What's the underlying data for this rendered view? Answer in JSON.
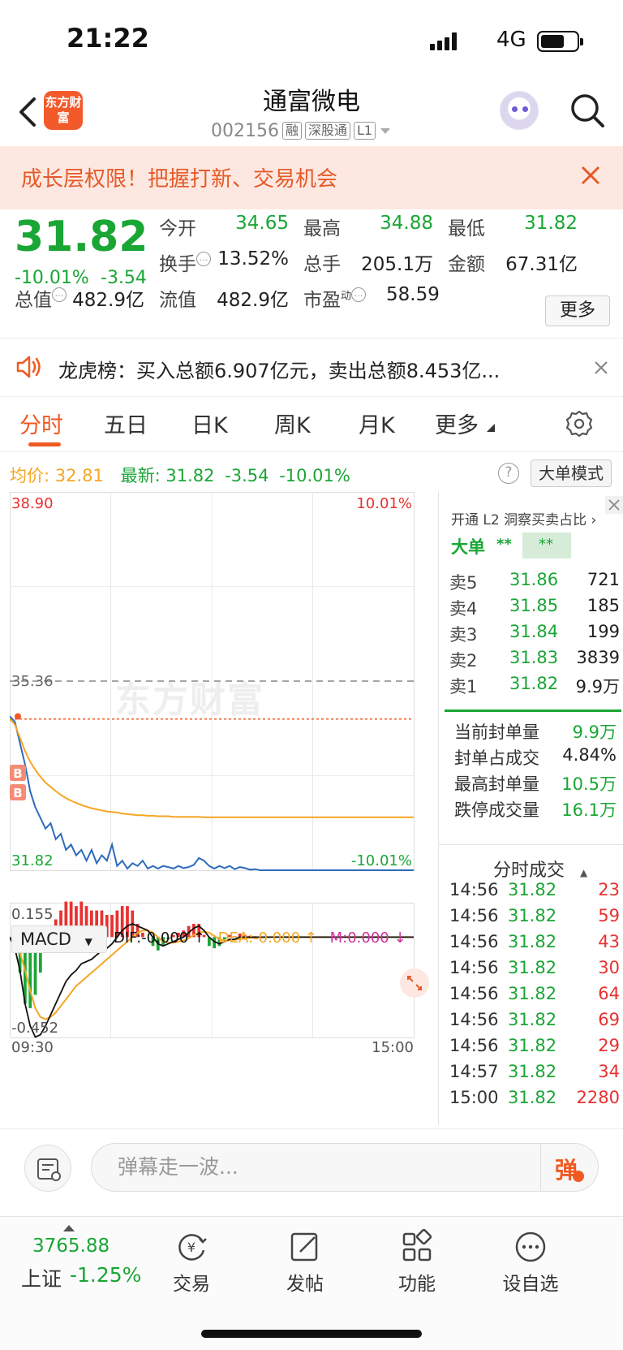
{
  "status": {
    "time": "21:22",
    "network": "4G"
  },
  "header": {
    "logo_text": "东方财富",
    "stock_name": "通富微电",
    "stock_code": "002156",
    "tags": [
      "融",
      "深股通",
      "L1"
    ]
  },
  "promo": {
    "text": "成长层权限！把握打新、交易机会"
  },
  "quote": {
    "price": "31.82",
    "pct": "-10.01%",
    "change": "-3.54",
    "fields": {
      "open_label": "今开",
      "open": "34.65",
      "high_label": "最高",
      "high": "34.88",
      "low_label": "最低",
      "low": "31.82",
      "turnover_label": "换手",
      "turnover": "13.52%",
      "volume_label": "总手",
      "volume": "205.1万",
      "amount_label": "金额",
      "amount": "67.31亿",
      "mktcap_label": "总值",
      "mktcap": "482.9亿",
      "float_label": "流值",
      "float": "482.9亿",
      "pe_label": "市盈",
      "pe_sup": "动",
      "pe": "58.59"
    },
    "more_label": "更多"
  },
  "dragon_tiger": {
    "text": "龙虎榜：买入总额6.907亿元，卖出总额8.453亿..."
  },
  "tabs": [
    "分时",
    "五日",
    "日K",
    "周K",
    "月K",
    "更多"
  ],
  "chart_info": {
    "avg_label": "均价:",
    "avg": "32.81",
    "latest_label": "最新:",
    "latest": "31.82",
    "change": "-3.54",
    "pct": "-10.01%",
    "help": "?",
    "big_order_mode": "大单模式"
  },
  "chart_data": {
    "type": "line",
    "y_top_label": "38.90",
    "y_top_pct": "10.01%",
    "y_mid_label": "35.36",
    "y_bottom_label": "31.82",
    "y_bottom_pct": "-10.01%",
    "ylim": [
      31.82,
      38.9
    ],
    "prev_close": 35.36,
    "limit_line": 34.65,
    "x_start": "09:30",
    "x_end": "15:00",
    "markers": [
      "B",
      "B"
    ],
    "series": [
      {
        "name": "最新",
        "color": "#2f6bbd",
        "values": [
          34.7,
          34.6,
          34.2,
          33.8,
          33.3,
          33.0,
          32.8,
          32.6,
          32.7,
          32.4,
          32.5,
          32.2,
          32.3,
          32.1,
          32.2,
          32.0,
          32.2,
          31.95,
          32.1,
          32.0,
          32.3,
          31.9,
          32.0,
          31.85,
          31.95,
          31.9,
          32.0,
          31.85,
          31.9,
          31.85,
          31.9,
          31.88,
          31.85,
          31.9,
          31.86,
          31.88,
          31.92,
          32.05,
          32.0,
          31.9,
          31.85,
          31.9,
          31.86,
          31.9,
          31.84,
          31.88,
          31.86,
          31.83,
          31.84,
          31.82,
          31.82,
          31.82,
          31.82,
          31.82,
          31.82,
          31.82,
          31.82,
          31.82,
          31.82,
          31.82,
          31.82,
          31.82,
          31.82,
          31.82,
          31.82,
          31.82,
          31.82,
          31.82,
          31.82,
          31.82,
          31.82,
          31.82,
          31.82,
          31.82,
          31.82,
          31.82,
          31.82,
          31.82,
          31.82,
          31.82
        ]
      },
      {
        "name": "均价",
        "color": "#f5a623",
        "values": [
          34.65,
          34.55,
          34.3,
          34.05,
          33.85,
          33.7,
          33.57,
          33.46,
          33.38,
          33.3,
          33.23,
          33.17,
          33.12,
          33.08,
          33.04,
          33.01,
          32.98,
          32.96,
          32.94,
          32.92,
          32.91,
          32.9,
          32.88,
          32.87,
          32.86,
          32.85,
          32.85,
          32.84,
          32.84,
          32.83,
          32.83,
          32.83,
          32.82,
          32.82,
          32.82,
          32.82,
          32.82,
          32.82,
          32.81,
          32.81,
          32.81,
          32.81,
          32.81,
          32.81,
          32.81,
          32.81,
          32.81,
          32.81,
          32.81,
          32.81,
          32.81,
          32.81,
          32.81,
          32.81,
          32.81,
          32.81,
          32.81,
          32.81,
          32.81,
          32.81,
          32.81,
          32.81,
          32.81,
          32.81,
          32.81,
          32.81,
          32.81,
          32.81,
          32.81,
          32.81,
          32.81,
          32.81,
          32.81,
          32.81,
          32.81,
          32.81,
          32.81,
          32.81,
          32.81,
          32.81
        ]
      }
    ],
    "macd": {
      "label": "MACD",
      "dif_text": "DIF:-0.000 ↑",
      "dea_text": "DEA:-0.000 ↑",
      "m_text": "M:0.000 ↓",
      "y_top": "0.155",
      "y_bottom": "-0.452",
      "ylim": [
        -0.452,
        0.155
      ],
      "dif": [
        0,
        -0.05,
        -0.15,
        -0.3,
        -0.4,
        -0.45,
        -0.44,
        -0.4,
        -0.35,
        -0.3,
        -0.25,
        -0.2,
        -0.17,
        -0.15,
        -0.12,
        -0.11,
        -0.1,
        -0.08,
        -0.06,
        -0.05,
        -0.03,
        0.0,
        0.03,
        0.05,
        0.06,
        0.05,
        0.04,
        0.03,
        0.0,
        -0.03,
        -0.04,
        -0.03,
        -0.02,
        -0.01,
        0.0,
        0.02,
        0.04,
        0.05,
        0.03,
        0.0,
        -0.02,
        -0.03,
        -0.02,
        -0.01,
        -0.01,
        0.0,
        0.0,
        0.0,
        0.0,
        0.0,
        0.0,
        0.0,
        0.0,
        0.0,
        0.0,
        0.0,
        0.0,
        0.0,
        0.0,
        0.0,
        0.0,
        0.0,
        0.0,
        0.0,
        0.0,
        0.0,
        0.0,
        0.0,
        0.0,
        0.0,
        0.0,
        0.0,
        0.0,
        0.0,
        0.0,
        0.0,
        0.0,
        0.0,
        0.0,
        0.0
      ],
      "dea": [
        0,
        -0.02,
        -0.07,
        -0.15,
        -0.24,
        -0.32,
        -0.36,
        -0.37,
        -0.36,
        -0.34,
        -0.31,
        -0.28,
        -0.25,
        -0.22,
        -0.2,
        -0.18,
        -0.16,
        -0.14,
        -0.12,
        -0.1,
        -0.08,
        -0.06,
        -0.04,
        -0.02,
        0.0,
        0.02,
        0.03,
        0.03,
        0.02,
        0.0,
        -0.02,
        -0.025,
        -0.025,
        -0.02,
        -0.015,
        -0.005,
        0.01,
        0.02,
        0.025,
        0.02,
        0.005,
        -0.01,
        -0.015,
        -0.015,
        -0.012,
        -0.008,
        -0.005,
        -0.003,
        -0.002,
        -0.001,
        0.0,
        0.0,
        0.0,
        0.0,
        0.0,
        0.0,
        0.0,
        0.0,
        0.0,
        0.0,
        0.0,
        0.0,
        0.0,
        0.0,
        0.0,
        0.0,
        0.0,
        0.0,
        0.0,
        0.0,
        0.0,
        0.0,
        0.0,
        0.0,
        0.0,
        0.0,
        0.0,
        0.0,
        0.0,
        0.0
      ],
      "dif_color": "#111111",
      "dea_color": "#f5a623",
      "up_color": "#e8312f",
      "down_color": "#1aa635"
    }
  },
  "right_panel": {
    "l2_link": "开通 L2 洞察买卖占比 ›",
    "big_order": "大单",
    "stars1": "**",
    "stars2": "**",
    "order_book": [
      {
        "label": "卖5",
        "price": "31.86",
        "vol": "721"
      },
      {
        "label": "卖4",
        "price": "31.85",
        "vol": "185"
      },
      {
        "label": "卖3",
        "price": "31.84",
        "vol": "199"
      },
      {
        "label": "卖2",
        "price": "31.83",
        "vol": "3839"
      },
      {
        "label": "卖1",
        "price": "31.82",
        "vol": "9.9万"
      }
    ],
    "seal": [
      {
        "label": "当前封单量",
        "value": "9.9万"
      },
      {
        "label": "封单占成交",
        "value": "4.84%"
      },
      {
        "label": "最高封单量",
        "value": "10.5万"
      },
      {
        "label": "跌停成交量",
        "value": "16.1万"
      }
    ],
    "ticks_title": "分时成交",
    "ticks": [
      {
        "time": "14:56",
        "price": "31.82",
        "vol": "23"
      },
      {
        "time": "14:56",
        "price": "31.82",
        "vol": "59"
      },
      {
        "time": "14:56",
        "price": "31.82",
        "vol": "43"
      },
      {
        "time": "14:56",
        "price": "31.82",
        "vol": "30"
      },
      {
        "time": "14:56",
        "price": "31.82",
        "vol": "64"
      },
      {
        "time": "14:56",
        "price": "31.82",
        "vol": "69"
      },
      {
        "time": "14:56",
        "price": "31.82",
        "vol": "29"
      },
      {
        "time": "14:57",
        "price": "31.82",
        "vol": "34"
      },
      {
        "time": "15:00",
        "price": "31.82",
        "vol": "2280"
      }
    ]
  },
  "danmaku": {
    "placeholder": "弹幕走一波...",
    "send": "弹"
  },
  "bottom_nav": {
    "index_value": "3765.88",
    "index_name": "上证",
    "index_pct": "-1.25%",
    "items": [
      "交易",
      "发帖",
      "功能",
      "设自选"
    ]
  },
  "colors": {
    "up": "#e8312f",
    "down": "#1aa635",
    "accent": "#f05a22",
    "price_line": "#2f6bbd",
    "avg_line": "#f5a623"
  }
}
